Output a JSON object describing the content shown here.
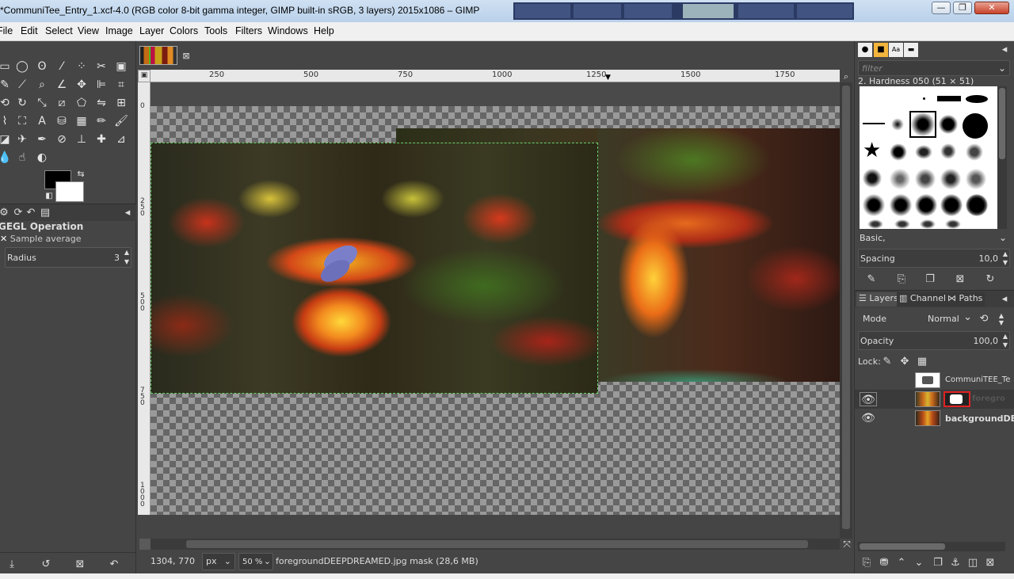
{
  "window": {
    "title": "*CommuniTee_Entry_1.xcf-4.0 (RGB color 8-bit gamma integer, GIMP built-in sRGB, 3 layers) 2015x1086 – GIMP",
    "minimize": "—",
    "maximize": "❐",
    "close": "✕"
  },
  "menubar": {
    "items": [
      "File",
      "Edit",
      "Select",
      "View",
      "Image",
      "Layer",
      "Colors",
      "Tools",
      "Filters",
      "Windows",
      "Help"
    ]
  },
  "toolbox": {
    "tool_options_title": "GEGL Operation",
    "sample_average": "Sample average",
    "radius_label": "Radius",
    "radius_value": "3",
    "panel_menu_icon": "◂"
  },
  "canvas": {
    "ruler_top_labels": [
      "250",
      "500",
      "750",
      "1000",
      "1250",
      "1500",
      "1750"
    ],
    "ruler_left_labels": [
      "0",
      "2\n5\n0",
      "5\n0\n0",
      "7\n5\n0",
      "1\n0\n0\n0"
    ]
  },
  "statusbar": {
    "coords": "1304, 770",
    "unit": "px",
    "zoom": "50 %",
    "message": "foregroundDEEPDREAMED.jpg mask (28,6 MB)"
  },
  "brushes": {
    "filter_placeholder": "filter",
    "selected_brush": "2. Hardness 050 (51 × 51)",
    "preset": "Basic,",
    "spacing_label": "Spacing",
    "spacing_value": "10,0"
  },
  "layers_panel": {
    "tabs": [
      "Layers",
      "Channels",
      "Paths"
    ],
    "mode_label": "Mode",
    "mode_value": "Normal",
    "opacity_label": "Opacity",
    "opacity_value": "100,0",
    "lock_label": "Lock:",
    "layers": [
      {
        "name": "CommuniTEE_Te",
        "visible": false
      },
      {
        "name": "foregro",
        "visible": true
      },
      {
        "name": "backgroundDE",
        "visible": true
      }
    ]
  }
}
